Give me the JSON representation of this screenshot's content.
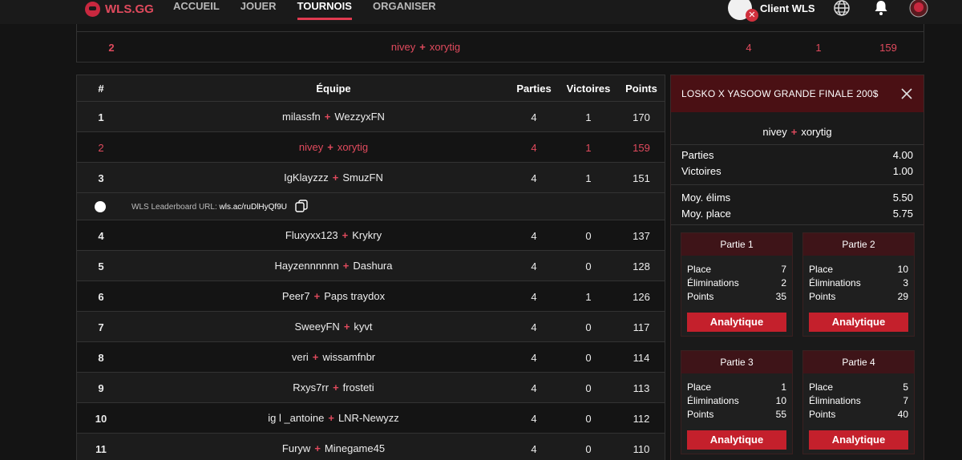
{
  "brand": {
    "name": "WLS.GG"
  },
  "nav": [
    {
      "label": "ACCUEIL"
    },
    {
      "label": "JOUER"
    },
    {
      "label": "TOURNOIS"
    },
    {
      "label": "ORGANISER"
    }
  ],
  "header_right": {
    "client_label": "Client WLS"
  },
  "top_table_row": {
    "rank": "2",
    "player1": "nivey",
    "player2": "xorytig",
    "parties": "4",
    "victoires": "1",
    "points": "159"
  },
  "table": {
    "columns": {
      "rank": "#",
      "team": "Équipe",
      "parties": "Parties",
      "victoires": "Victoires",
      "points": "Points"
    },
    "rows": [
      {
        "rank": "1",
        "player1": "milassfn",
        "player2": "WezzyxFN",
        "parties": "4",
        "victoires": "1",
        "points": "170"
      },
      {
        "rank": "2",
        "player1": "nivey",
        "player2": "xorytig",
        "parties": "4",
        "victoires": "1",
        "points": "159"
      },
      {
        "rank": "3",
        "player1": "IgKlayzzz",
        "player2": "SmuzFN",
        "parties": "4",
        "victoires": "1",
        "points": "151"
      },
      {
        "rank": "4",
        "player1": "Fluxyxx123",
        "player2": "Krykry",
        "parties": "4",
        "victoires": "0",
        "points": "137"
      },
      {
        "rank": "5",
        "player1": "Hayzennnnnn",
        "player2": "Dashura",
        "parties": "4",
        "victoires": "0",
        "points": "128"
      },
      {
        "rank": "6",
        "player1": "Peer7",
        "player2": "Paps traydox",
        "parties": "4",
        "victoires": "1",
        "points": "126"
      },
      {
        "rank": "7",
        "player1": "SweeyFN",
        "player2": "kyvt",
        "parties": "4",
        "victoires": "0",
        "points": "117"
      },
      {
        "rank": "8",
        "player1": "veri",
        "player2": "wissamfnbr",
        "parties": "4",
        "victoires": "0",
        "points": "114"
      },
      {
        "rank": "9",
        "player1": "Rxys7rr",
        "player2": "frosteti",
        "parties": "4",
        "victoires": "0",
        "points": "113"
      },
      {
        "rank": "10",
        "player1": "ig l _antoine",
        "player2": "LNR-Newyzz",
        "parties": "4",
        "victoires": "0",
        "points": "112"
      },
      {
        "rank": "11",
        "player1": "Furyw",
        "player2": "Minegame45",
        "parties": "4",
        "victoires": "0",
        "points": "110"
      }
    ],
    "url_row": {
      "label": "WLS Leaderboard URL:",
      "value": "wls.ac/ruDlHyQf9U"
    }
  },
  "panel": {
    "title": "LOSKO X YASOOW GRANDE FINALE 200$",
    "player1": "nivey",
    "player2": "xorytig",
    "stats": [
      {
        "label": "Parties",
        "value": "4.00"
      },
      {
        "label": "Victoires",
        "value": "1.00"
      },
      {
        "label": "Moy. élims",
        "value": "5.50"
      },
      {
        "label": "Moy. place",
        "value": "5.75"
      }
    ],
    "games": [
      {
        "title": "Partie 1",
        "place_label": "Place",
        "place": "7",
        "elim_label": "Éliminations",
        "elims": "2",
        "points_label": "Points",
        "points": "35",
        "button": "Analytique"
      },
      {
        "title": "Partie 2",
        "place_label": "Place",
        "place": "10",
        "elim_label": "Éliminations",
        "elims": "3",
        "points_label": "Points",
        "points": "29",
        "button": "Analytique"
      },
      {
        "title": "Partie 3",
        "place_label": "Place",
        "place": "1",
        "elim_label": "Éliminations",
        "elims": "10",
        "points_label": "Points",
        "points": "55",
        "button": "Analytique"
      },
      {
        "title": "Partie 4",
        "place_label": "Place",
        "place": "5",
        "elim_label": "Éliminations",
        "elims": "7",
        "points_label": "Points",
        "points": "40",
        "button": "Analytique"
      }
    ]
  },
  "colors": {
    "accent": "#e04a5d",
    "panel_header": "#4a1014",
    "button": "#c4202c"
  }
}
